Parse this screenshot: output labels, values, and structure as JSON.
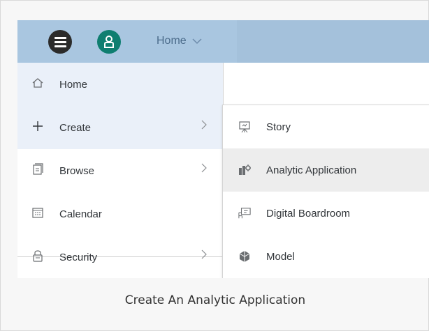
{
  "shellbar": {
    "menu_icon": "hamburger-icon",
    "avatar_icon": "user-icon",
    "avatar_color": "#0f7e70",
    "home_label": "Home",
    "home_chevron_icon": "chevron-down-icon",
    "background": "#a9c6e0"
  },
  "left_menu": {
    "items": [
      {
        "label": "Home",
        "icon": "home-icon"
      },
      {
        "label": "Create",
        "icon": "plus-icon",
        "chevron": true
      },
      {
        "label": "Browse",
        "icon": "browse-icon",
        "chevron": true
      },
      {
        "label": "Calendar",
        "icon": "calendar-icon"
      },
      {
        "label": "Security",
        "icon": "lock-icon",
        "chevron": true
      }
    ],
    "active_color": "#eaf0f9"
  },
  "sub_menu": {
    "items": [
      {
        "label": "Story",
        "icon": "presentation-icon"
      },
      {
        "label": "Analytic Application",
        "icon": "analytic-application-icon"
      },
      {
        "label": "Digital Boardroom",
        "icon": "boardroom-icon"
      },
      {
        "label": "Model",
        "icon": "cube-icon"
      }
    ],
    "hover_color": "#ededed"
  },
  "caption": "Create An Analytic Application"
}
